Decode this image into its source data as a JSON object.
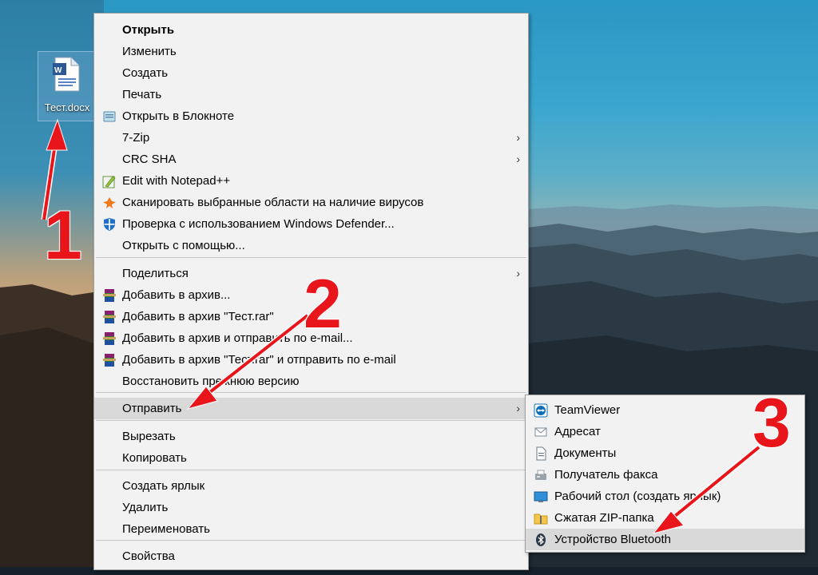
{
  "desktop": {
    "icon_label": "Тест.docx"
  },
  "menu": {
    "items": [
      {
        "label": "Открыть",
        "bold": true
      },
      {
        "label": "Изменить"
      },
      {
        "label": "Создать"
      },
      {
        "label": "Печать"
      },
      {
        "label": "Открыть в Блокноте",
        "icon": "notepad-icon"
      },
      {
        "label": "7-Zip",
        "submenu": true
      },
      {
        "label": "CRC SHA",
        "submenu": true
      },
      {
        "label": "Edit with Notepad++",
        "icon": "notepadpp-icon"
      },
      {
        "label": "Сканировать выбранные области на наличие вирусов",
        "icon": "avast-icon"
      },
      {
        "label": "Проверка с использованием Windows Defender...",
        "icon": "defender-icon"
      },
      {
        "label": "Открыть с помощью..."
      },
      {
        "label": "Поделиться",
        "submenu": true
      },
      {
        "label": "Добавить в архив...",
        "icon": "winrar-icon"
      },
      {
        "label": "Добавить в архив \"Тест.rar\"",
        "icon": "winrar-icon"
      },
      {
        "label": "Добавить в архив и отправить по e-mail...",
        "icon": "winrar-icon"
      },
      {
        "label": "Добавить в архив \"Тест.rar\" и отправить по e-mail",
        "icon": "winrar-icon"
      },
      {
        "label": "Восстановить прежнюю версию"
      },
      {
        "label": "Отправить",
        "submenu": true,
        "highlighted": true
      },
      {
        "label": "Вырезать"
      },
      {
        "label": "Копировать"
      },
      {
        "label": "Создать ярлык"
      },
      {
        "label": "Удалить"
      },
      {
        "label": "Переименовать"
      },
      {
        "label": "Свойства"
      }
    ],
    "submenu_arrow": "›"
  },
  "send_to": {
    "items": [
      {
        "label": "TeamViewer",
        "icon": "teamviewer-icon"
      },
      {
        "label": "Адресат",
        "icon": "mail-recipient-icon"
      },
      {
        "label": "Документы",
        "icon": "documents-icon"
      },
      {
        "label": "Получатель факса",
        "icon": "fax-icon"
      },
      {
        "label": "Рабочий стол (создать ярлык)",
        "icon": "desktop-icon"
      },
      {
        "label": "Сжатая ZIP-папка",
        "icon": "zip-folder-icon"
      },
      {
        "label": "Устройство Bluetooth",
        "icon": "bluetooth-icon",
        "highlighted": true
      }
    ]
  },
  "annotations": {
    "step1": "1",
    "step2": "2",
    "step3": "3",
    "color": "#e8151b"
  },
  "colors": {
    "menu_bg": "#f2f2f2",
    "highlight": "#d9d9d9",
    "separator": "#c8c8c8"
  }
}
